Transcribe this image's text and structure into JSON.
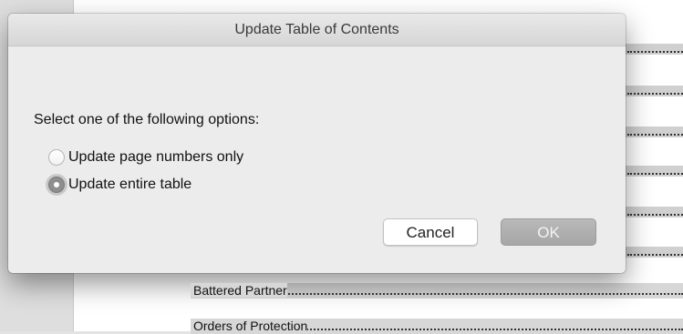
{
  "dialog": {
    "title": "Update Table of Contents",
    "prompt": "Select one of the following options:",
    "options": [
      {
        "label": "Update page numbers only",
        "selected": false
      },
      {
        "label": "Update entire table",
        "selected": true
      }
    ],
    "cancel_label": "Cancel",
    "ok_label": "OK"
  },
  "document": {
    "toc_entries": [
      {
        "text": "Battered Partner"
      },
      {
        "text": "Orders of Protection"
      }
    ]
  }
}
